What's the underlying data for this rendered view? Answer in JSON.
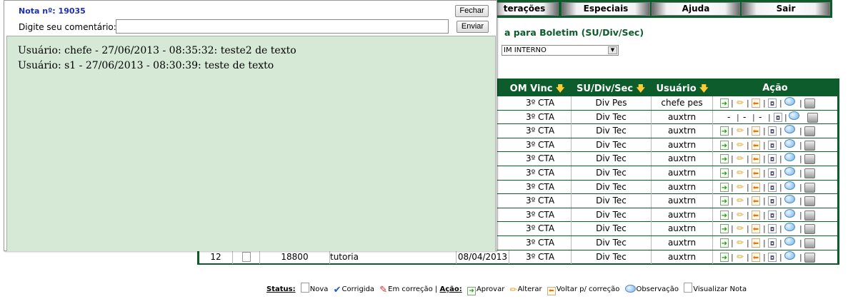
{
  "menubar": {
    "items": [
      {
        "id": "alteracoes",
        "label": "terações"
      },
      {
        "id": "especiais",
        "label": "Especiais"
      },
      {
        "id": "ajuda",
        "label": "Ajuda"
      },
      {
        "id": "sair",
        "label": "Sair"
      }
    ]
  },
  "page": {
    "heading_partial": "a para Boletim (SU/Div/Sec)",
    "category_select_value": "IM INTERNO"
  },
  "table": {
    "headers": {
      "om_vinc": "OM Vinc",
      "su_div_sec": "SU/Div/Sec",
      "usuario": "Usuário",
      "acao": "Ação"
    },
    "rows": [
      {
        "om": "3º CTA",
        "su": "Div Pes",
        "user": "chefe pes",
        "actions": "full"
      },
      {
        "om": "3º CTA",
        "su": "Div Tec",
        "user": "auxtrn",
        "actions": "restricted"
      },
      {
        "om": "3º CTA",
        "su": "Div Tec",
        "user": "auxtrn",
        "actions": "full"
      },
      {
        "om": "3º CTA",
        "su": "Div Tec",
        "user": "auxtrn",
        "actions": "full"
      },
      {
        "om": "3º CTA",
        "su": "Div Tec",
        "user": "auxtrn",
        "actions": "full"
      },
      {
        "om": "3º CTA",
        "su": "Div Tec",
        "user": "auxtrn",
        "actions": "full"
      },
      {
        "om": "3º CTA",
        "su": "Div Tec",
        "user": "auxtrn",
        "actions": "full"
      },
      {
        "om": "3º CTA",
        "su": "Div Tec",
        "user": "auxtrn",
        "actions": "full"
      },
      {
        "om": "3º CTA",
        "su": "Div Tec",
        "user": "auxtrn",
        "actions": "full"
      },
      {
        "om": "3º CTA",
        "su": "Div Tec",
        "user": "auxtrn",
        "actions": "full"
      },
      {
        "om": "3º CTA",
        "su": "Div Tec",
        "user": "auxtrn",
        "actions": "full"
      },
      {
        "num": "12",
        "doc": "18800",
        "assunto": "tutoria",
        "data": "08/04/2013",
        "om": "3º CTA",
        "su": "Div Tec",
        "user": "auxtrn",
        "actions": "full"
      }
    ],
    "restricted_dash": "-",
    "action_sep": "|"
  },
  "legend": {
    "status_label": "Status:",
    "nova": "Nova",
    "corrigida": "Corrigida",
    "em_correcao": "Em correção",
    "separator": "|",
    "acao_label": "Ação:",
    "aprovar": "Aprovar",
    "alterar": "Alterar",
    "voltar": "Voltar p/ correção",
    "observacao": "Observação",
    "visualizar": "Visualizar Nota"
  },
  "popup": {
    "note_number": "Nota nº: 19035",
    "close_label": "Fechar",
    "comment_label": "Digite seu comentário:",
    "comment_value": "",
    "send_label": "Enviar",
    "comments": [
      "Usuário: chefe - 27/06/2013 - 08:35:32: teste2 de texto",
      "Usuário: s1 - 27/06/2013 - 08:30:39: teste de texto"
    ]
  },
  "colors": {
    "brand_green": "#0d5c2c",
    "popup_panel": "#d6e8d6",
    "note_number_blue": "#1a2fb8",
    "sort_arrow": "#ffcc33"
  },
  "icons": {
    "aprovar": "green-arrow-right-icon",
    "alterar": "pencil-icon",
    "voltar": "orange-arrow-left-icon",
    "visualizar": "magnifier-document-icon",
    "observacao": "speech-bubble-icon",
    "imprimir": "printer-icon",
    "nova": "blank-document-icon",
    "corrigida": "blue-check-icon",
    "em_correcao": "red-pen-icon"
  }
}
